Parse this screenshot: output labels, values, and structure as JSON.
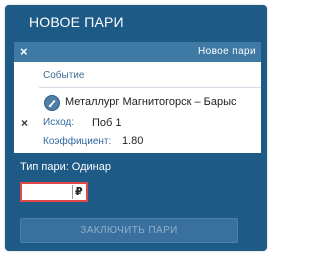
{
  "widget": {
    "title": "НОВОЕ ПАРИ"
  },
  "panel": {
    "close_icon": "×",
    "header_label": "Новое пари"
  },
  "bet": {
    "column_header": "Событие",
    "remove_icon": "×",
    "sport_icon": "sport-icon",
    "match": "Металлург Магнитогорск – Барыс",
    "outcome_label": "Исход:",
    "outcome_value": "Поб 1",
    "coefficient_label": "Коэффициент:",
    "coefficient_value": "1.80"
  },
  "bet_type": {
    "label": "Тип пари:",
    "value": "Одинар"
  },
  "stake": {
    "value": "",
    "currency_symbol": "₽"
  },
  "actions": {
    "submit_label": "ЗАКЛЮЧИТЬ ПАРИ"
  },
  "colors": {
    "panel_background": "#1d5a86",
    "header_bar": "#3f7aa5",
    "label_blue": "#2f6aa0",
    "error_border": "#e04848",
    "button_disabled": "#3a709d"
  }
}
